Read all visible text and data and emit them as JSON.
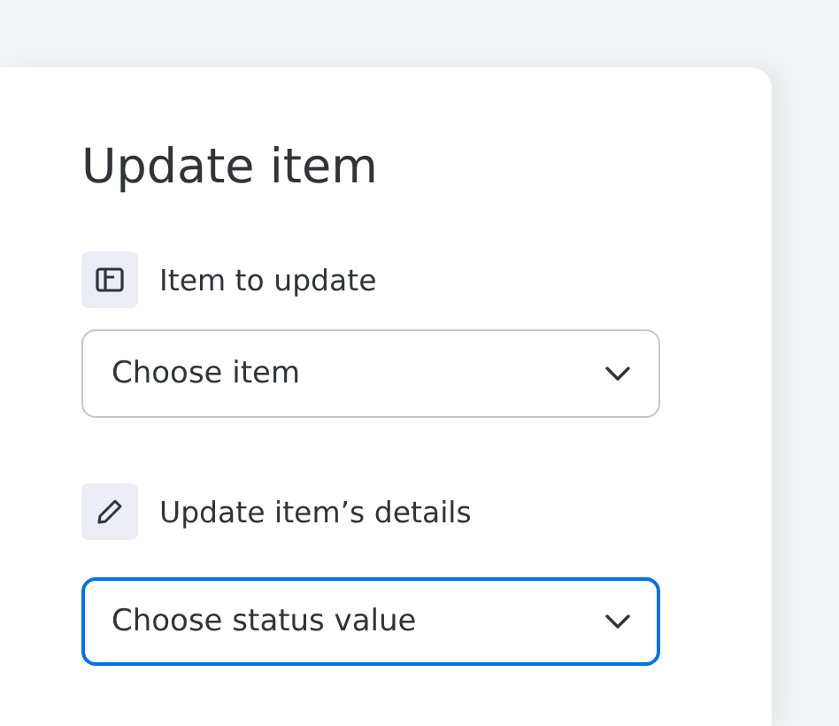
{
  "title": "Update item",
  "sections": [
    {
      "label": "Item to update",
      "dropdown": {
        "placeholder": "Choose item",
        "focused": false
      }
    },
    {
      "label": "Update item’s details",
      "dropdown": {
        "placeholder": "Choose status value",
        "focused": true
      }
    }
  ]
}
